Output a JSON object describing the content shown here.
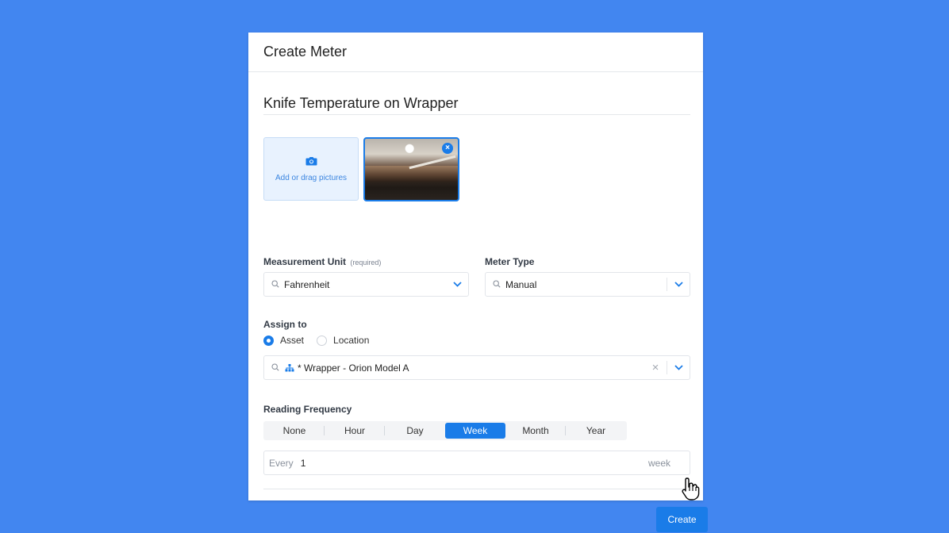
{
  "modal": {
    "title": "Create Meter",
    "name_value": "Knife Temperature on Wrapper"
  },
  "pictures": {
    "add_label": "Add or drag pictures",
    "remove_label": "×"
  },
  "measurement_unit": {
    "label": "Measurement Unit",
    "required": "(required)",
    "value": "Fahrenheit"
  },
  "meter_type": {
    "label": "Meter Type",
    "value": "Manual"
  },
  "assign_to": {
    "label": "Assign to",
    "options": [
      {
        "label": "Asset",
        "selected": true
      },
      {
        "label": "Location",
        "selected": false
      }
    ],
    "asset_value": "* Wrapper - Orion Model A",
    "clear_label": "×"
  },
  "reading_frequency": {
    "label": "Reading Frequency",
    "options": [
      "None",
      "Hour",
      "Day",
      "Week",
      "Month",
      "Year"
    ],
    "selected": "Week",
    "every_prefix": "Every",
    "every_value": "1",
    "every_suffix": "week"
  },
  "footer": {
    "create_label": "Create"
  },
  "colors": {
    "background": "#4286f0",
    "accent": "#1a7ce8"
  }
}
